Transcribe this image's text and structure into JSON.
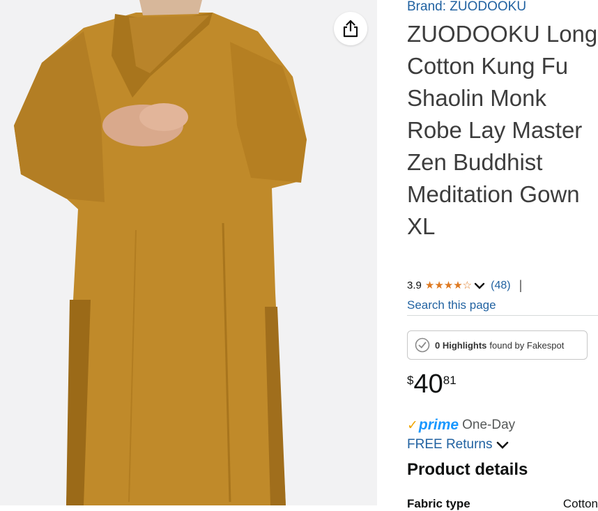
{
  "gallery": {
    "image_alt": "Monk robe product photo",
    "share_icon": "share-icon",
    "robe_color": "#c08a2a"
  },
  "product": {
    "brand_link": "Brand: ZUODOOKU",
    "title": "ZUODOOKU Long Cotton Kung Fu Shaolin Monk Robe Lay Master Zen Buddhist Meditation Gown XL",
    "rating_value": "3.9",
    "rating_stars": 3.9,
    "rating_count": "(48)",
    "separator": "|",
    "search_link": "Search this page",
    "fakespot": {
      "count_label": "0 Highlights",
      "suffix": "found by Fakespot"
    },
    "price": {
      "currency": "$",
      "whole": "40",
      "fraction": "81"
    },
    "prime": {
      "logo": "prime",
      "service": "One-Day"
    },
    "returns_link": "FREE Returns",
    "details_heading": "Product details",
    "details_first_row": {
      "label": "Fabric type",
      "value": "Cotton"
    }
  },
  "colors": {
    "link": "#2162a1",
    "star": "#de7921",
    "prime": "#1a98ff"
  }
}
